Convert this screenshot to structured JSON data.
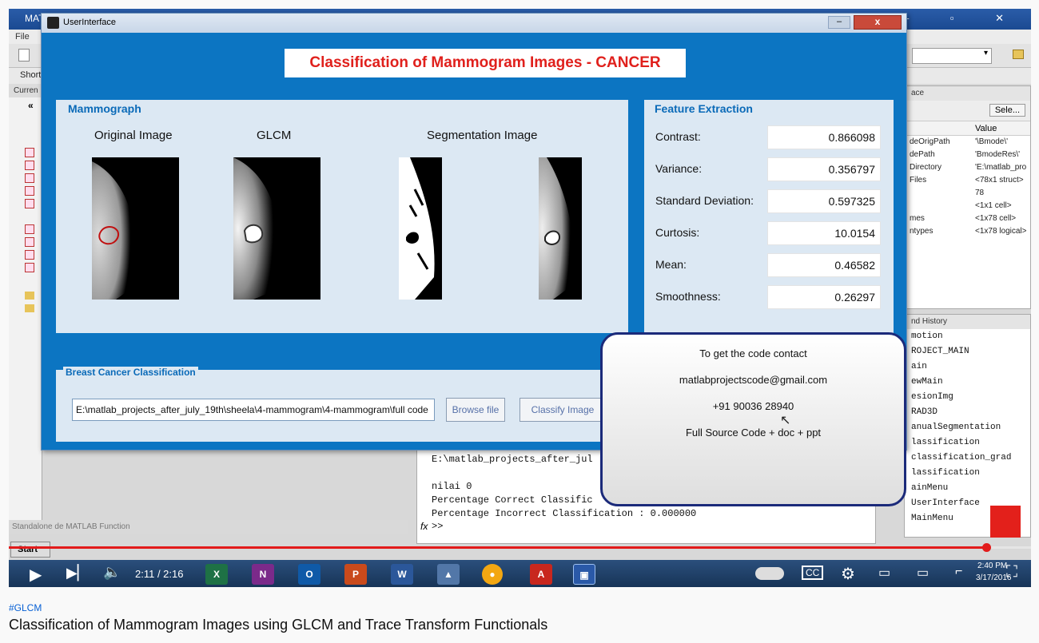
{
  "matlab": {
    "title": "MAT",
    "menu": "File",
    "shortcuts": "Short",
    "left_header": "Curren",
    "left_nav": "«",
    "status_text": "Standalone de MATLAB Function",
    "start_label": "Start",
    "workspace": {
      "header": "ace",
      "select_label": "Sele...",
      "value_col": "Value",
      "rows": [
        {
          "name": "deOrigPath",
          "value": "'\\Bmode\\'"
        },
        {
          "name": "dePath",
          "value": "'BmodeRes\\'"
        },
        {
          "name": "Directory",
          "value": "'E:\\matlab_pro"
        },
        {
          "name": "Files",
          "value": "<78x1 struct>"
        },
        {
          "name": "",
          "value": "78"
        },
        {
          "name": "",
          "value": "<1x1 cell>"
        },
        {
          "name": "mes",
          "value": "<1x78 cell>"
        },
        {
          "name": "ntypes",
          "value": "<1x78 logical>"
        }
      ]
    },
    "history": {
      "header": "nd History",
      "items": [
        "motion",
        "ROJECT_MAIN",
        "ain",
        "ewMain",
        "esionImg",
        "RAD3D",
        "anualSegmentation",
        "lassification",
        "classification_grad",
        "lassification",
        "ainMenu",
        "UserInterface",
        "MainMenu"
      ]
    },
    "command_window": {
      "lines": [
        "E:\\matlab_projects_after_jul",
        "",
        "nilai 0",
        "Percentage Correct Classific",
        "Percentage Incorrect Classification : 0.000000"
      ],
      "prompt": ">>",
      "fx": "fx"
    }
  },
  "ui_window": {
    "title": "UserInterface",
    "min_label": "‒",
    "close_label": "x",
    "app_title": "Classification of Mammogram Images - CANCER",
    "mammograph": {
      "legend": "Mammograph",
      "original_label": "Original Image",
      "glcm_label": "GLCM",
      "segmentation_label": "Segmentation Image"
    },
    "features": {
      "legend": "Feature Extraction",
      "items": [
        {
          "label": "Contrast:",
          "value": "0.866098"
        },
        {
          "label": "Variance:",
          "value": "0.356797"
        },
        {
          "label": "Standard Deviation:",
          "value": "0.597325"
        },
        {
          "label": "Curtosis:",
          "value": "10.0154"
        },
        {
          "label": "Mean:",
          "value": "0.46582"
        },
        {
          "label": "Smoothness:",
          "value": "0.26297"
        }
      ]
    },
    "classification": {
      "legend": "Breast Cancer Classification",
      "path_value": "E:\\matlab_projects_after_july_19th\\sheela\\4-mammogram\\4-mammogram\\full code",
      "browse_label": "Browse file",
      "classify_label": "Classify Image"
    }
  },
  "contact": {
    "line1": "To get the code contact",
    "email": "matlabprojectscode@gmail.com",
    "phone": "+91 90036 28940",
    "offer": "Full Source Code + doc + ppt"
  },
  "player": {
    "time": "2:11 / 2:16",
    "progress": 0.956,
    "clock_time": "2:40 PM",
    "clock_date": "3/17/2016",
    "apps": [
      "X",
      "N",
      "O",
      "P",
      "W"
    ],
    "colors": {
      "accent": "#e21b1b",
      "panel_blue": "#0c75c2",
      "title_red": "#e0201c"
    }
  },
  "video": {
    "hashtag": "#GLCM",
    "title": "Classification of Mammogram Images using GLCM and Trace Transform Functionals"
  }
}
